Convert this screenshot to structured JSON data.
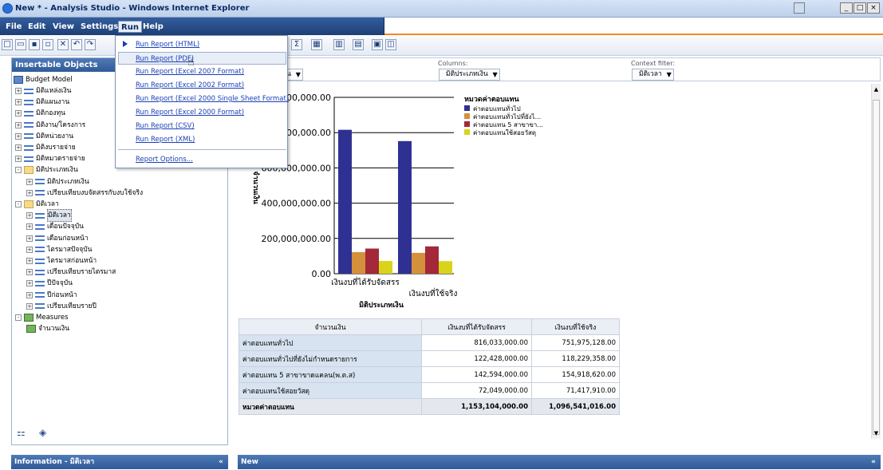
{
  "window": {
    "title": "New * - Analysis Studio - Windows Internet Explorer",
    "buttons": [
      "_",
      "□",
      "×"
    ]
  },
  "menubar": {
    "items": [
      "File",
      "Edit",
      "View",
      "Settings",
      "Run",
      "Help"
    ],
    "active": "Run"
  },
  "run_menu": {
    "items": [
      "Run Report (HTML)",
      "Run Report (PDF)",
      "Run Report (Excel 2007 Format)",
      "Run Report (Excel 2002 Format)",
      "Run Report (Excel 2000 Single Sheet Format)",
      "Run Report (Excel 2000 Format)",
      "Run Report (CSV)",
      "Run Report (XML)"
    ],
    "options": "Report Options...",
    "highlighted": "Run Report (PDF)"
  },
  "left_panel": {
    "header": "Insertable Objects",
    "root": "Budget Model",
    "tree": [
      {
        "label": "มิติแหล่งเงิน",
        "level": 1,
        "type": "dim",
        "expand": "+"
      },
      {
        "label": "มิติแผนงาน",
        "level": 1,
        "type": "dim",
        "expand": "+"
      },
      {
        "label": "มิติกองทุน",
        "level": 1,
        "type": "dim",
        "expand": "+"
      },
      {
        "label": "มิติงาน/โครงการ",
        "level": 1,
        "type": "dim",
        "expand": "+"
      },
      {
        "label": "มิติหน่วยงาน",
        "level": 1,
        "type": "dim",
        "expand": "+"
      },
      {
        "label": "มิติงบรายจ่าย",
        "level": 1,
        "type": "dim",
        "expand": "+"
      },
      {
        "label": "มิติหมวดรายจ่าย",
        "level": 1,
        "type": "dim",
        "expand": "+"
      },
      {
        "label": "มิติประเภทเงิน",
        "level": 1,
        "type": "folder",
        "expand": "-"
      },
      {
        "label": "มิติประเภทเงิน",
        "level": 2,
        "type": "dim",
        "expand": "+"
      },
      {
        "label": "เปรียบเทียบงบจัดสรรกับงบใช้จริง",
        "level": 2,
        "type": "dim",
        "expand": "+"
      },
      {
        "label": "มิติเวลา",
        "level": 1,
        "type": "folder",
        "expand": "-"
      },
      {
        "label": "มิติเวลา",
        "level": 2,
        "type": "dim",
        "expand": "+",
        "selected": true
      },
      {
        "label": "เดือนปัจจุบัน",
        "level": 2,
        "type": "dim",
        "expand": "+"
      },
      {
        "label": "เดือนก่อนหน้า",
        "level": 2,
        "type": "dim",
        "expand": "+"
      },
      {
        "label": "ไตรมาสปัจจุบัน",
        "level": 2,
        "type": "dim",
        "expand": "+"
      },
      {
        "label": "ไตรมาสก่อนหน้า",
        "level": 2,
        "type": "dim",
        "expand": "+"
      },
      {
        "label": "เปรียบเทียบรายไตรมาส",
        "level": 2,
        "type": "dim",
        "expand": "+"
      },
      {
        "label": "ปีปัจจุบัน",
        "level": 2,
        "type": "dim",
        "expand": "+"
      },
      {
        "label": "ปีก่อนหน้า",
        "level": 2,
        "type": "dim",
        "expand": "+"
      },
      {
        "label": "เปรียบเทียบรายปี",
        "level": 2,
        "type": "dim",
        "expand": "+"
      },
      {
        "label": "Measures",
        "level": 1,
        "type": "measures",
        "expand": "-"
      },
      {
        "label": "จำนวนเงิน",
        "level": 2,
        "type": "measure",
        "expand": ""
      }
    ]
  },
  "info_bar": "Information - มิติเวลา",
  "new_bar": "New",
  "drop_zones": {
    "rows_chip": "แทน",
    "columns_label": "Columns:",
    "columns_chip": "มิติประเภทเงิน",
    "context_label": "Context filter:",
    "context_chip": "มิติเวลา"
  },
  "chart_data": {
    "type": "bar",
    "categories": [
      "เงินงบที่ได้รับจัดสรร",
      "เงินงบที่ใช้จริง"
    ],
    "series": [
      {
        "name": "ค่าตอบแทนทั่วไป",
        "values": [
          816033000,
          751975128
        ]
      },
      {
        "name": "ค่าตอบแทนทั่วไปที่ยังไ...",
        "values": [
          122428000,
          118229358
        ]
      },
      {
        "name": "ค่าตอบแทน 5 สาขาขา...",
        "values": [
          142594000,
          154918620
        ]
      },
      {
        "name": "ค่าตอบแทนใช้สอยวัสดุ",
        "values": [
          72049000,
          71417910
        ]
      }
    ],
    "colors": [
      "#2e3192",
      "#d4913b",
      "#a3283a",
      "#d9d319"
    ],
    "legend_title": "หมวดค่าตอบแทน",
    "xlabel": "มิติประเภทเงิน",
    "ylabel": "จำนวนเงิน",
    "y_tick_labels": [
      "0.00",
      "200,000,000.00",
      "400,000,000.00",
      "600,000,000.00",
      "800,000,000.00",
      "1,000,000,000.00"
    ],
    "y_tick_values": [
      0,
      200000000,
      400000000,
      600000000,
      800000000,
      1000000000
    ],
    "ylim": [
      0,
      1000000000
    ],
    "legend_position": "top-right"
  },
  "table": {
    "corner": "จำนวนเงิน",
    "columns": [
      "เงินงบที่ได้รับจัดสรร",
      "เงินงบที่ใช้จริง"
    ],
    "rows": [
      {
        "label": "ค่าตอบแทนทั่วไป",
        "values": [
          "816,033,000.00",
          "751,975,128.00"
        ]
      },
      {
        "label": "ค่าตอบแทนทั่วไปที่ยังไม่กำหนดรายการ",
        "values": [
          "122,428,000.00",
          "118,229,358.00"
        ]
      },
      {
        "label": "ค่าตอบแทน 5 สาขาขาดแคลน(พ.ต.ส)",
        "values": [
          "142,594,000.00",
          "154,918,620.00"
        ]
      },
      {
        "label": "ค่าตอบแทนใช้สอยวัสดุ",
        "values": [
          "72,049,000.00",
          "71,417,910.00"
        ]
      }
    ],
    "total": {
      "label": "หมวดค่าตอบแทน",
      "values": [
        "1,153,104,000.00",
        "1,096,541,016.00"
      ]
    }
  }
}
